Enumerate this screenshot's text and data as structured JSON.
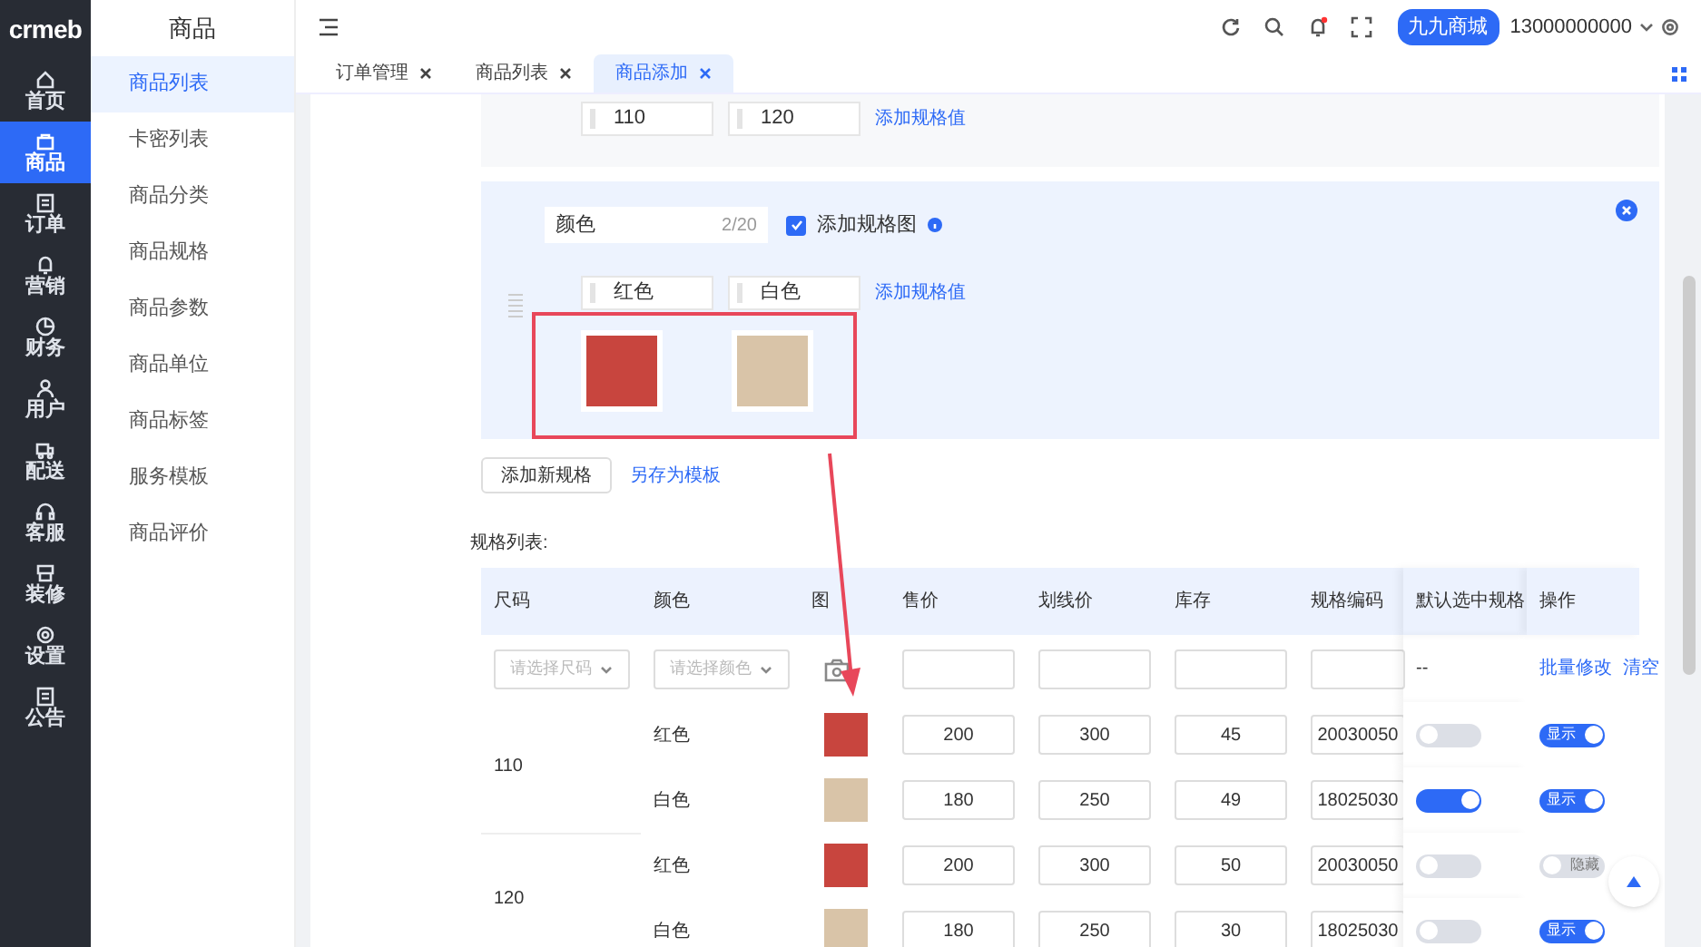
{
  "logo": "crmeb",
  "nav": [
    {
      "label": "首页",
      "selected": false
    },
    {
      "label": "商品",
      "selected": true
    },
    {
      "label": "订单",
      "selected": false
    },
    {
      "label": "营销",
      "selected": false
    },
    {
      "label": "财务",
      "selected": false
    },
    {
      "label": "用户",
      "selected": false
    },
    {
      "label": "配送",
      "selected": false
    },
    {
      "label": "客服",
      "selected": false
    },
    {
      "label": "装修",
      "selected": false
    },
    {
      "label": "设置",
      "selected": false
    },
    {
      "label": "公告",
      "selected": false
    }
  ],
  "submenu": {
    "title": "商品",
    "items": [
      {
        "label": "商品列表",
        "selected": true
      },
      {
        "label": "卡密列表",
        "selected": false
      },
      {
        "label": "商品分类",
        "selected": false
      },
      {
        "label": "商品规格",
        "selected": false
      },
      {
        "label": "商品参数",
        "selected": false
      },
      {
        "label": "商品单位",
        "selected": false
      },
      {
        "label": "商品标签",
        "selected": false
      },
      {
        "label": "服务模板",
        "selected": false
      },
      {
        "label": "商品评价",
        "selected": false
      }
    ]
  },
  "header": {
    "store": "九九商城",
    "account": "13000000000"
  },
  "tabs": [
    {
      "label": "订单管理",
      "selected": false
    },
    {
      "label": "商品列表",
      "selected": false
    },
    {
      "label": "商品添加",
      "selected": true
    }
  ],
  "spec_groups": [
    {
      "values": [
        "110",
        "120"
      ],
      "add_value": "添加规格值"
    },
    {
      "name": "颜色",
      "counter": "2/20",
      "values": [
        "红色",
        "白色"
      ],
      "add_value": "添加规格值",
      "add_image": {
        "label": "添加规格图",
        "checked": true
      }
    }
  ],
  "add_spec_button": "添加新规格",
  "save_template_link": "另存为模板",
  "table": {
    "title": "规格列表:",
    "columns": [
      "尺码",
      "颜色",
      "图",
      "售价",
      "划线价",
      "库存",
      "规格编码",
      "默认选中规格",
      "操作"
    ],
    "filter_row": {
      "size_placeholder": "请选择尺码",
      "color_placeholder": "请选择颜色",
      "default": "--",
      "batch_edit": "批量修改",
      "clear": "清空"
    },
    "groups": [
      {
        "size": "110",
        "rows": [
          {
            "spec_value": "红色",
            "price": "200",
            "list_price": "300",
            "stock": "45",
            "code": "20030050",
            "default_selected": false,
            "display": {
              "label": "显示",
              "on": true
            }
          },
          {
            "spec_value": "白色",
            "price": "180",
            "list_price": "250",
            "stock": "49",
            "code": "18025030",
            "default_selected": true,
            "display": {
              "label": "显示",
              "on": true
            }
          }
        ]
      },
      {
        "size": "120",
        "rows": [
          {
            "spec_value": "红色",
            "price": "200",
            "list_price": "300",
            "stock": "50",
            "code": "20030050",
            "default_selected": false,
            "display": {
              "label": "隐藏",
              "on": false
            }
          },
          {
            "spec_value": "白色",
            "price": "180",
            "list_price": "250",
            "stock": "30",
            "code": "18025030",
            "default_selected": false,
            "display": {
              "label": "显示",
              "on": true
            }
          }
        ]
      }
    ]
  }
}
